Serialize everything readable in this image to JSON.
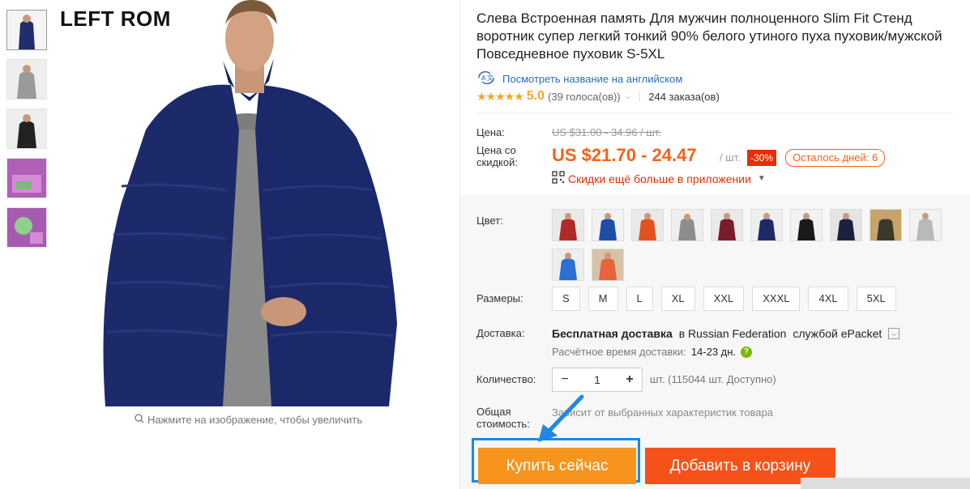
{
  "image": {
    "brand_text": "LEFT ROM",
    "zoom_hint": "Нажмите на изображение, чтобы увеличить"
  },
  "product": {
    "title": "Слева Встроенная память Для мужчин полноценного Slim Fit Стенд воротник супер легкий тонкий 90% белого утиного пуха пуховик/мужской Повседневное пуховик S-5XL",
    "translate_link": "Посмотреть название на английском",
    "rating": {
      "stars": "★★★★★",
      "score": "5.0",
      "votes": "(39 голоса(ов))",
      "orders": "244 заказа(ов)"
    }
  },
  "pricing": {
    "price_label": "Цена:",
    "old_price": "US $31.00 - 34.96 / шт.",
    "discount_label": "Цена со скидкой:",
    "price": "US $21.70 - 24.47",
    "per_unit": "/ шт.",
    "discount_badge": "-30%",
    "days_left": "Осталось дней: 6",
    "app_promo": "Скидки ещё больше в приложении"
  },
  "options": {
    "color_label": "Цвет:",
    "colors": [
      "red-jacket",
      "blue-jacket",
      "orange-jacket",
      "gray-hooded-jacket",
      "wine-jacket",
      "navy-jacket",
      "black-jacket",
      "dark-navy-jacket",
      "khaki-jacket",
      "light-gray-jacket",
      "royal-blue-jacket",
      "coral-jacket"
    ],
    "size_label": "Размеры:",
    "sizes": [
      "S",
      "M",
      "L",
      "XL",
      "XXL",
      "XXXL",
      "4XL",
      "5XL"
    ]
  },
  "shipping": {
    "label": "Доставка:",
    "free_prefix": "Бесплатная доставка",
    "free_middle": " в Russian Federation ",
    "carrier": "службой ePacket",
    "est_label": "Расчётное время доставки:",
    "est_days": "14-23 дн."
  },
  "quantity": {
    "label": "Количество:",
    "value": "1",
    "info": "шт. (115044 шт. Доступно)"
  },
  "total": {
    "label": "Общая стоимость:",
    "info": "Зависит от выбранных характеристик товара"
  },
  "actions": {
    "buy_now": "Купить сейчас",
    "add_to_cart": "Добавить в корзину"
  },
  "colors_theme": {
    "price": "#f5621a",
    "buy_now": "#f7941d",
    "add_cart": "#f5521a",
    "highlight": "#1e88e5",
    "link": "#2a6ebb"
  }
}
